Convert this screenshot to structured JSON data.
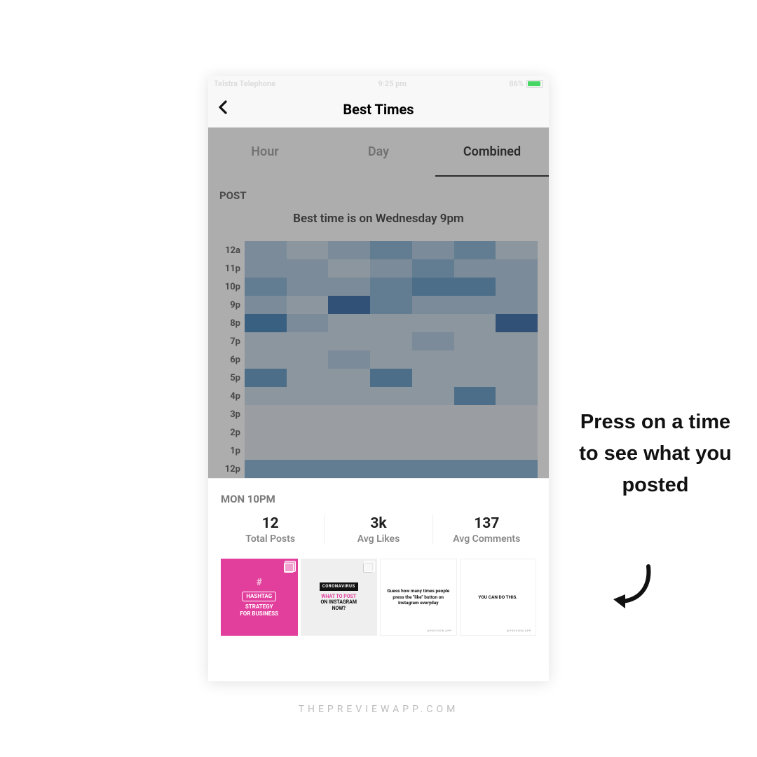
{
  "statusbar": {
    "carrier": "Telstra Telephone",
    "time": "9:25 pm",
    "battery_pct": "86%"
  },
  "header": {
    "title": "Best Times"
  },
  "tabs": {
    "hour": "Hour",
    "day": "Day",
    "combined": "Combined"
  },
  "section_label": "POST",
  "best_time_text": "Best time is on Wednesday 9pm",
  "chart_data": {
    "type": "heatmap",
    "rows": [
      "12a",
      "11p",
      "10p",
      "9p",
      "8p",
      "7p",
      "6p",
      "5p",
      "4p",
      "3p",
      "2p",
      "1p",
      "12p"
    ],
    "cols_count": 7,
    "title": "Best time is on Wednesday 9pm",
    "values": [
      [
        3,
        2,
        3,
        4,
        3,
        4,
        2
      ],
      [
        3,
        3,
        2,
        3,
        4,
        3,
        3
      ],
      [
        4,
        3,
        3,
        4,
        5,
        5,
        3
      ],
      [
        3,
        2,
        7,
        4,
        3,
        3,
        3
      ],
      [
        6,
        3,
        2,
        2,
        2,
        2,
        7
      ],
      [
        2,
        2,
        2,
        2,
        3,
        2,
        2
      ],
      [
        2,
        2,
        3,
        2,
        2,
        2,
        2
      ],
      [
        5,
        2,
        2,
        5,
        2,
        2,
        2
      ],
      [
        2,
        2,
        2,
        2,
        2,
        5,
        2
      ],
      [
        1,
        1,
        1,
        1,
        1,
        1,
        1
      ],
      [
        1,
        1,
        1,
        1,
        1,
        1,
        1
      ],
      [
        1,
        1,
        1,
        1,
        1,
        1,
        1
      ],
      [
        4,
        4,
        4,
        4,
        4,
        4,
        4
      ]
    ],
    "palette": [
      "#e9e9e9",
      "#dfe6ec",
      "#c7d7e5",
      "#a9c5dd",
      "#7faccf",
      "#5b93c2",
      "#3a7bb4",
      "#2a63a0"
    ]
  },
  "sheet": {
    "selected_label": "MON 10PM",
    "stats": [
      {
        "value": "12",
        "label": "Total Posts"
      },
      {
        "value": "3k",
        "label": "Avg Likes"
      },
      {
        "value": "137",
        "label": "Avg Comments"
      }
    ],
    "thumbs": [
      {
        "kind": "pink",
        "hash": "#",
        "tag": "HASHTAG",
        "line1": "STRATEGY",
        "line2": "FOR BUSINESS",
        "multi": true
      },
      {
        "kind": "light",
        "badge": "CORONAVIRUS",
        "pink": "WHAT TO POST",
        "black1": "ON INSTAGRAM",
        "black2": "NOW?",
        "multi": true
      },
      {
        "kind": "white",
        "text": "Guess how many times people press the \"like\" button on Instagram everyday",
        "wm": "@PREVIEW.APP"
      },
      {
        "kind": "white",
        "text": "YOU CAN DO THIS.",
        "wm": "@PREVIEW.APP"
      }
    ]
  },
  "annotation": "Press on a time to see what you posted",
  "footer_url": "THEPREVIEWAPP.COM"
}
